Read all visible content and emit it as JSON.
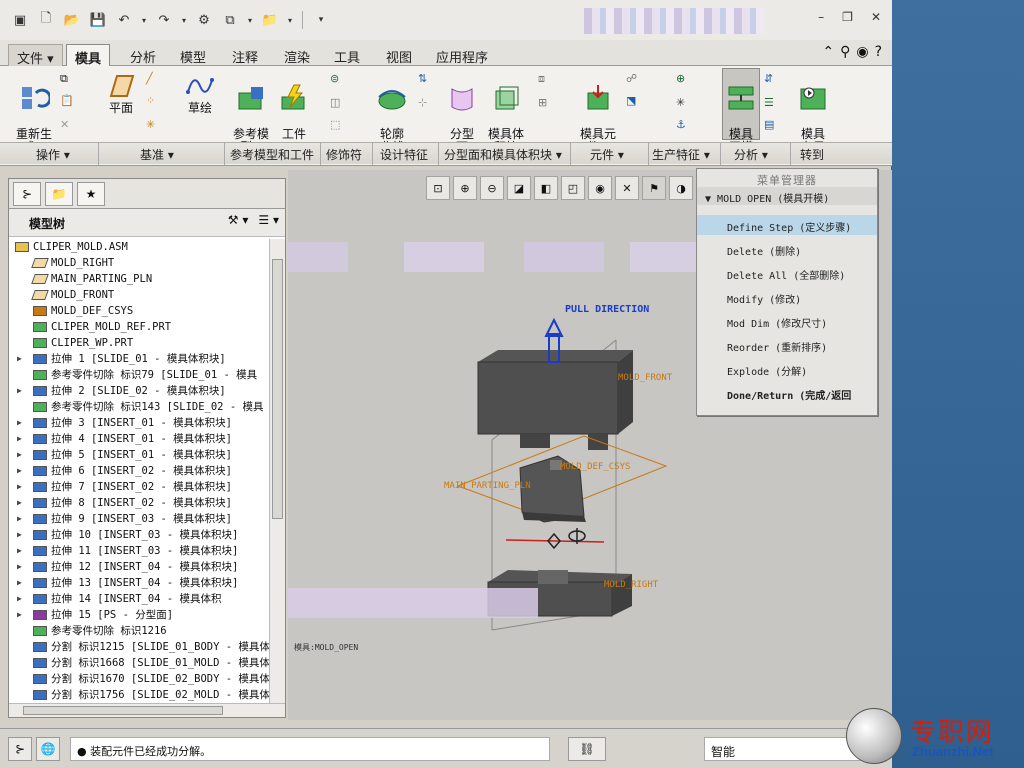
{
  "quick_access": {
    "icons": [
      "window-icon",
      "new-icon",
      "open-icon",
      "save-icon",
      "undo-icon",
      "redo-icon",
      "regenerate-icon",
      "windows-icon",
      "folder-icon",
      "customize-icon"
    ]
  },
  "window_controls": {
    "minimize": "–",
    "restore": "❐",
    "close": "✕"
  },
  "ribbon_tabs": {
    "file": "文件 ▾",
    "mold": "模具",
    "analysis": "分析",
    "model": "模型",
    "annotate": "注释",
    "render": "渲染",
    "tools": "工具",
    "view": "视图",
    "apps": "应用程序"
  },
  "ribbon": {
    "regenerate": "重新生\n成 ▾",
    "plane": "平面",
    "sketch": "草绘",
    "ref_model": "参考模\n型 ▾",
    "workpiece": "工件\n▾",
    "silhouette": "轮廓\n曲线",
    "parting_surface": "分型\n面",
    "mold_volume": "模具体\n积块",
    "mold_component": "模具元\n件 ▾",
    "mold_open": "模具\n开模",
    "mold_layout": "模具\n布局"
  },
  "groups": {
    "operations": "操作 ▾",
    "datum": "基准 ▾",
    "ref_model_workpiece": "参考模型和工件",
    "modifiers": "修饰符",
    "design_features": "设计特征",
    "parting_volume": "分型面和模具体积块 ▾",
    "components": "元件 ▾",
    "production": "生产特征 ▾",
    "analysis": "分析 ▾",
    "goto": "转到"
  },
  "model_tree": {
    "title": "模型树",
    "tools_icon": "⚒ ▾",
    "settings_icon": "☰ ▾",
    "rows": [
      {
        "text": "CLIPER_MOLD.ASM",
        "icon": "asm",
        "expand": false,
        "indent": 0
      },
      {
        "text": "MOLD_RIGHT",
        "icon": "plane",
        "expand": false,
        "indent": 1
      },
      {
        "text": "MAIN_PARTING_PLN",
        "icon": "plane",
        "expand": false,
        "indent": 1
      },
      {
        "text": "MOLD_FRONT",
        "icon": "plane",
        "expand": false,
        "indent": 1
      },
      {
        "text": "MOLD_DEF_CSYS",
        "icon": "csys",
        "expand": false,
        "indent": 1
      },
      {
        "text": "CLIPER_MOLD_REF.PRT",
        "icon": "part",
        "expand": false,
        "indent": 1
      },
      {
        "text": "CLIPER_WP.PRT",
        "icon": "part",
        "expand": false,
        "indent": 1
      },
      {
        "text": "拉伸 1 [SLIDE_01 - 模具体积块]",
        "icon": "extrude",
        "expand": true,
        "indent": 1
      },
      {
        "text": "参考零件切除 标识79 [SLIDE_01 - 模具",
        "icon": "cut",
        "expand": false,
        "indent": 1
      },
      {
        "text": "拉伸 2 [SLIDE_02 - 模具体积块]",
        "icon": "extrude",
        "expand": true,
        "indent": 1
      },
      {
        "text": "参考零件切除 标识143 [SLIDE_02 - 模具",
        "icon": "cut",
        "expand": false,
        "indent": 1
      },
      {
        "text": "拉伸 3 [INSERT_01 - 模具体积块]",
        "icon": "extrude",
        "expand": true,
        "indent": 1
      },
      {
        "text": "拉伸 4 [INSERT_01 - 模具体积块]",
        "icon": "extrude",
        "expand": true,
        "indent": 1
      },
      {
        "text": "拉伸 5 [INSERT_01 - 模具体积块]",
        "icon": "extrude",
        "expand": true,
        "indent": 1
      },
      {
        "text": "拉伸 6 [INSERT_02 - 模具体积块]",
        "icon": "extrude",
        "expand": true,
        "indent": 1
      },
      {
        "text": "拉伸 7 [INSERT_02 - 模具体积块]",
        "icon": "extrude",
        "expand": true,
        "indent": 1
      },
      {
        "text": "拉伸 8 [INSERT_02 - 模具体积块]",
        "icon": "extrude",
        "expand": true,
        "indent": 1
      },
      {
        "text": "拉伸 9 [INSERT_03 - 模具体积块]",
        "icon": "extrude",
        "expand": true,
        "indent": 1
      },
      {
        "text": "拉伸 10 [INSERT_03 - 模具体积块]",
        "icon": "extrude",
        "expand": true,
        "indent": 1
      },
      {
        "text": "拉伸 11 [INSERT_03 - 模具体积块]",
        "icon": "extrude",
        "expand": true,
        "indent": 1
      },
      {
        "text": "拉伸 12 [INSERT_04 - 模具体积块]",
        "icon": "extrude",
        "expand": true,
        "indent": 1
      },
      {
        "text": "拉伸 13 [INSERT_04 - 模具体积块]",
        "icon": "extrude",
        "expand": true,
        "indent": 1
      },
      {
        "text": "拉伸 14 [INSERT_04 - 模具体积",
        "icon": "extrude",
        "expand": true,
        "indent": 1
      },
      {
        "text": "拉伸 15 [PS - 分型面]",
        "icon": "surface",
        "expand": true,
        "indent": 1
      },
      {
        "text": "参考零件切除 标识1216",
        "icon": "cut2",
        "expand": false,
        "indent": 1
      },
      {
        "text": "分割 标识1215 [SLIDE_01_BODY - 模具体",
        "icon": "split",
        "expand": false,
        "indent": 1
      },
      {
        "text": "分割 标识1668 [SLIDE_01_MOLD - 模具体",
        "icon": "split",
        "expand": false,
        "indent": 1
      },
      {
        "text": "分割 标识1670 [SLIDE_02_BODY - 模具体",
        "icon": "split",
        "expand": false,
        "indent": 1
      },
      {
        "text": "分割 标识1756 [SLIDE_02_MOLD - 模具体",
        "icon": "split",
        "expand": false,
        "indent": 1
      }
    ]
  },
  "graphics": {
    "pull_direction": "PULL DIRECTION",
    "mold_front": "MOLD_FRONT",
    "mold_def_csys": "MOLD_DEF_CSYS",
    "main_parting": "MAIN_PARTING_PLN",
    "mold_right": "MOLD_RIGHT",
    "mode_label": "模具:MOLD_OPEN"
  },
  "menu_manager": {
    "title": "菜单管理器",
    "header": "MOLD OPEN (模具开模)",
    "items": [
      {
        "label": "Define Step (定义步骤)",
        "highlight": true,
        "bold": false
      },
      {
        "label": "Delete (删除)",
        "highlight": false,
        "bold": false
      },
      {
        "label": "Delete All (全部删除)",
        "highlight": false,
        "bold": false
      },
      {
        "label": "Modify (修改)",
        "highlight": false,
        "bold": false
      },
      {
        "label": "Mod Dim (修改尺寸)",
        "highlight": false,
        "bold": false
      },
      {
        "label": "Reorder (重新排序)",
        "highlight": false,
        "bold": false
      },
      {
        "label": "Explode (分解)",
        "highlight": false,
        "bold": false
      },
      {
        "label": "Done/Return (完成/返回",
        "highlight": false,
        "bold": true
      }
    ]
  },
  "status": {
    "message": "● 装配元件已经成功分解。",
    "filter": "智能"
  },
  "watermark": {
    "cn": "专职网",
    "en": "Zhuanzhi.Net"
  },
  "colors": {
    "accent_blue": "#1a3cc8",
    "label_orange": "#c87a10",
    "highlight": "#b9d7e8"
  }
}
